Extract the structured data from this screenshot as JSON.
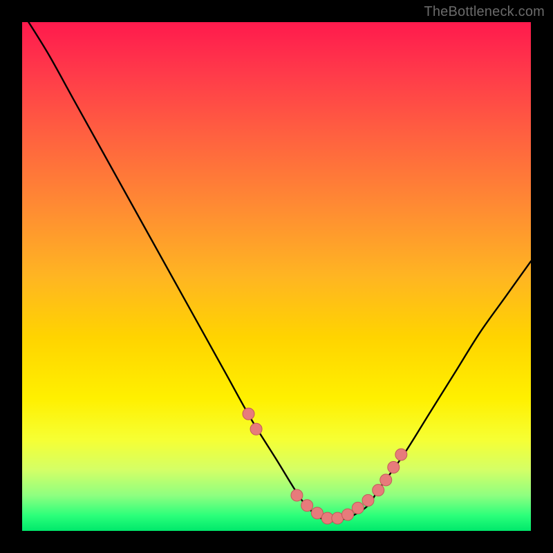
{
  "watermark": "TheBottleneck.com",
  "chart_data": {
    "type": "line",
    "title": "",
    "xlabel": "",
    "ylabel": "",
    "xlim": [
      0,
      100
    ],
    "ylim": [
      0,
      100
    ],
    "series": [
      {
        "name": "bottleneck-curve",
        "x": [
          0,
          5,
          10,
          15,
          20,
          25,
          30,
          35,
          40,
          45,
          50,
          55,
          58,
          60,
          62,
          65,
          68,
          70,
          75,
          80,
          85,
          90,
          95,
          100
        ],
        "values": [
          102,
          94,
          85,
          76,
          67,
          58,
          49,
          40,
          31,
          22,
          14,
          6,
          3,
          2,
          2,
          3,
          5,
          8,
          15,
          23,
          31,
          39,
          46,
          53
        ]
      }
    ],
    "markers": {
      "name": "highlight-dots",
      "x": [
        44.5,
        46,
        54,
        56,
        58,
        60,
        62,
        64,
        66,
        68,
        70,
        71.5,
        73,
        74.5
      ],
      "values": [
        23,
        20,
        7,
        5,
        3.5,
        2.5,
        2.5,
        3.2,
        4.5,
        6,
        8,
        10,
        12.5,
        15
      ]
    },
    "grid": false,
    "legend": false
  },
  "colors": {
    "curve": "#000000",
    "marker_fill": "#e77b7b",
    "marker_stroke": "#c25a5a"
  }
}
